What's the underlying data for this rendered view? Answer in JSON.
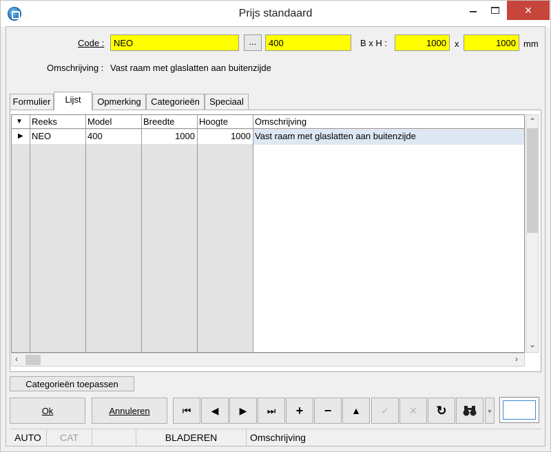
{
  "window": {
    "title": "Prijs standaard",
    "close_glyph": "×"
  },
  "form": {
    "code_label": "Code :",
    "code_value": "NEO",
    "dots_label": "...",
    "model_value": "400",
    "size_label": "B x H :",
    "width_value": "1000",
    "x_label": "x",
    "height_value": "1000",
    "unit_label": "mm",
    "desc_label": "Omschrijving :",
    "desc_value": "Vast raam met glaslatten aan buitenzijde"
  },
  "tabs": [
    {
      "label": "Formulier"
    },
    {
      "label": "Lijst"
    },
    {
      "label": "Opmerking"
    },
    {
      "label": "Categorieën"
    },
    {
      "label": "Speciaal"
    }
  ],
  "active_tab": "Lijst",
  "grid": {
    "columns": [
      "Reeks",
      "Model",
      "Breedte",
      "Hoogte",
      "Omschrijving"
    ],
    "rows": [
      [
        "NEO",
        "400",
        "1000",
        "1000",
        "Vast raam met glaslatten aan buitenzijde"
      ]
    ]
  },
  "buttons": {
    "apply_categories": "Categorieën toepassen",
    "ok": "Ok",
    "cancel": "Annuleren"
  },
  "nav_icons": [
    "first-icon",
    "prev-icon",
    "next-icon",
    "last-icon",
    "add-icon",
    "remove-icon",
    "up-icon",
    "confirm-icon",
    "cancel-edit-icon",
    "refresh-icon",
    "binoculars-icon"
  ],
  "status": {
    "auto": "AUTO",
    "cat": "CAT",
    "blank": "",
    "mode": "BLADEREN",
    "field": "Omschrijving"
  },
  "colors": {
    "required_field": "#ffff00",
    "selected_row": "#dde8f3",
    "close_button": "#c7453a"
  }
}
